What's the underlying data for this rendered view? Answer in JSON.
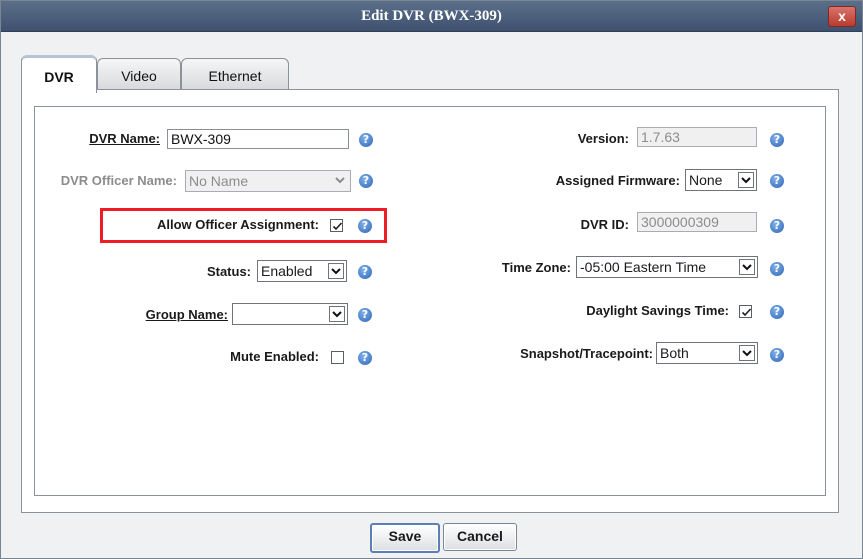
{
  "window": {
    "title": "Edit DVR (BWX-309)",
    "close_label": "x"
  },
  "tabs": [
    {
      "label": "DVR",
      "active": true
    },
    {
      "label": "Video",
      "active": false
    },
    {
      "label": "Ethernet",
      "active": false
    }
  ],
  "left": {
    "dvr_name": {
      "label": "DVR Name:",
      "value": "BWX-309"
    },
    "officer_name": {
      "label": "DVR Officer Name:",
      "value": "No Name",
      "disabled": true
    },
    "allow_assignment": {
      "label": "Allow Officer Assignment:",
      "checked": true
    },
    "status": {
      "label": "Status:",
      "value": "Enabled"
    },
    "group_name": {
      "label": "Group Name:",
      "value": ""
    },
    "mute_enabled": {
      "label": "Mute Enabled:",
      "checked": false
    }
  },
  "right": {
    "version": {
      "label": "Version:",
      "value": "1.7.63"
    },
    "firmware": {
      "label": "Assigned Firmware:",
      "value": "None"
    },
    "dvr_id": {
      "label": "DVR ID:",
      "value": "3000000309"
    },
    "time_zone": {
      "label": "Time Zone:",
      "value": "-05:00 Eastern Time"
    },
    "daylight_savings": {
      "label": "Daylight Savings Time:",
      "checked": true
    },
    "snapshot": {
      "label": "Snapshot/Tracepoint:",
      "value": "Both"
    }
  },
  "help_symbol": "?",
  "buttons": {
    "save": "Save",
    "cancel": "Cancel"
  },
  "colors": {
    "title_bar": "#4a5f7f",
    "highlight": "#ee1c24",
    "help_icon": "#2f66b5"
  }
}
